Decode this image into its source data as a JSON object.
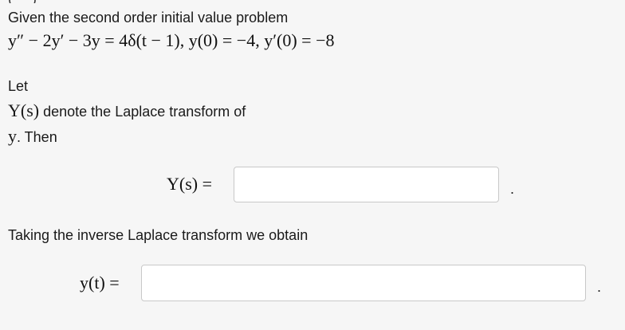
{
  "top_clipped_text": "( - ) -",
  "prompt": "Given the second order initial value problem",
  "equation": "y″ − 2y′ − 3y = 4δ(t − 1),  y(0) = −4,  y′(0) = −8",
  "let_label": "Let",
  "ys_line": {
    "math": "Y(s)",
    "text": " denote the Laplace transform of"
  },
  "y_then": {
    "math": "y",
    "text": ". Then"
  },
  "laplace_answer": {
    "label": "Y(s) =",
    "value": "",
    "placeholder": "",
    "trailing": "."
  },
  "inverse_text": "Taking the inverse Laplace transform we obtain",
  "time_answer": {
    "label": "y(t) =",
    "value": "",
    "placeholder": "",
    "trailing": "."
  }
}
